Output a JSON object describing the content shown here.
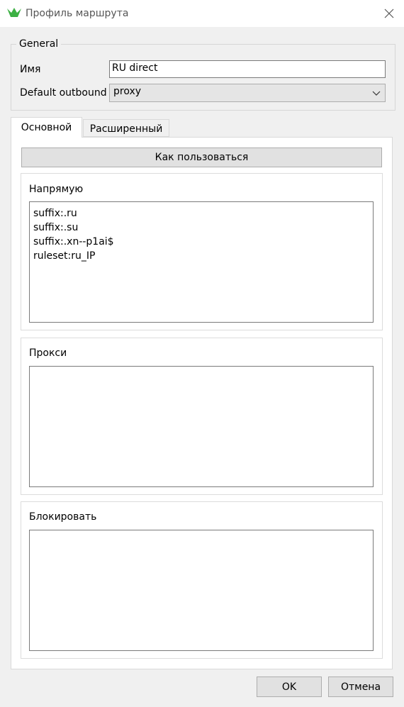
{
  "window": {
    "title": "Профиль маршрута"
  },
  "general": {
    "legend": "General",
    "name_label": "Имя",
    "name_value": "RU direct",
    "outbound_label": "Default outbound",
    "outbound_value": "proxy"
  },
  "tabs": [
    {
      "label": "Основной",
      "active": true
    },
    {
      "label": "Расширенный",
      "active": false
    }
  ],
  "main": {
    "help_button": "Как пользоваться",
    "direct": {
      "label": "Напрямую",
      "lines": [
        "suffix:.ru",
        "suffix:.su",
        "suffix:.xn--p1ai$",
        "ruleset:ru_IP"
      ]
    },
    "proxy": {
      "label": "Прокси"
    },
    "block": {
      "label": "Блокировать"
    }
  },
  "footer": {
    "ok": "OK",
    "cancel": "Отмена"
  },
  "colors": {
    "brand_green": "#3cb043"
  }
}
